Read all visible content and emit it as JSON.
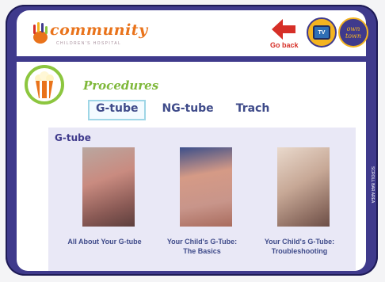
{
  "header": {
    "logo_word": "community",
    "logo_sub": "CHILDREN'S HOSPITAL",
    "go_back_label": "Go back",
    "tv_label": "TV",
    "own_town_line1": "own",
    "own_town_line2": "town"
  },
  "section": {
    "title": "Procedures",
    "tabs": [
      {
        "label": "G-tube",
        "active": true
      },
      {
        "label": "NG-tube",
        "active": false
      },
      {
        "label": "Trach",
        "active": false
      }
    ]
  },
  "panel": {
    "title": "G-tube",
    "cards": [
      {
        "caption_line1": "All About Your G-tube",
        "caption_line2": ""
      },
      {
        "caption_line1": "Your Child's G-Tube:",
        "caption_line2": "The Basics"
      },
      {
        "caption_line1": "Your Child's G-Tube:",
        "caption_line2": "Troubleshooting"
      }
    ]
  },
  "scrollbar": {
    "label": "SCROLL BAR AREA"
  },
  "colors": {
    "frame": "#3f3a8c",
    "accent_green": "#7fb83a",
    "logo_orange": "#e9731b",
    "back_red": "#d62f27"
  }
}
